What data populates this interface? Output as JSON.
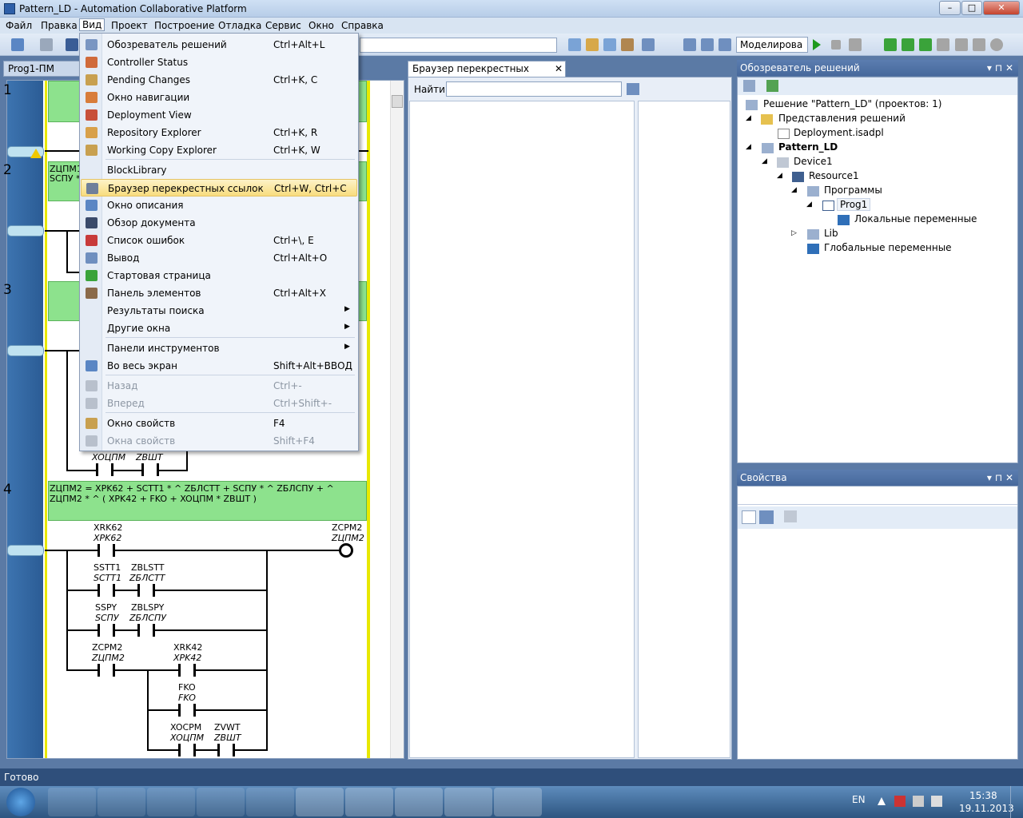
{
  "window": {
    "title": "Pattern_LD - Automation Collaborative Platform",
    "min": "–",
    "max": "□",
    "close": "✕"
  },
  "menubar": [
    "Файл",
    "Правка",
    "Вид",
    "Проект",
    "Построение",
    "Отладка",
    "Сервис",
    "Окно",
    "Справка"
  ],
  "toolbar": {
    "sim_mode": "Моделирова"
  },
  "editor": {
    "tab": "Prog1-ПМ",
    "rungs": [
      {
        "num": "1"
      },
      {
        "num": "2",
        "text_a": "ZЦПМ1",
        "text_b": "SCПУ *"
      },
      {
        "num": "3"
      },
      {
        "num": "4",
        "expr": "ZЦПМ2  =  XPK62 + SCTT1 * ^  ZБЛСТТ + SCПУ * ^  ZБЛСПУ + ^  ZЦПМ2 * ^  (   XPK42 + FKO + XOЦПМ * ZBШТ )"
      }
    ],
    "r3_labels": {
      "a": "XOЦПМ",
      "b": "ZBШТ"
    },
    "r4": {
      "c1": {
        "top": "XRK62",
        "bot": "XPK62"
      },
      "coil": {
        "top": "ZCPM2",
        "bot": "ZЦПМ2"
      },
      "c2": {
        "top": "SSTT1",
        "bot": "SCTT1"
      },
      "c3": {
        "top": "ZBLSTT",
        "bot": "ZБЛСТТ"
      },
      "c4": {
        "top": "SSPY",
        "bot": "SCПУ"
      },
      "c5": {
        "top": "ZBLSPY",
        "bot": "ZБЛСПУ"
      },
      "c6": {
        "top": "ZCPM2",
        "bot": "ZЦПМ2"
      },
      "c7": {
        "top": "XRK42",
        "bot": "XPK42"
      },
      "c8": {
        "top": "FKO",
        "bot": "FKO"
      },
      "c9": {
        "top": "XOCPM",
        "bot": "XOЦПМ"
      },
      "c10": {
        "top": "ZVWT",
        "bot": "ZBШТ"
      }
    }
  },
  "cross_ref": {
    "tab": "Браузер перекрестных ссылок",
    "close": "✕",
    "find_label": "Найти"
  },
  "solution": {
    "title": "Обозреватель решений",
    "pin": "▾ ⊓ ✕",
    "items": [
      {
        "label": "Решение \"Pattern_LD\"  (проектов: 1)"
      },
      {
        "label": "Представления решений"
      },
      {
        "label": "Deployment.isadpl"
      },
      {
        "label": "Pattern_LD"
      },
      {
        "label": "Device1"
      },
      {
        "label": "Resource1"
      },
      {
        "label": "Программы"
      },
      {
        "label": "Prog1"
      },
      {
        "label": "Локальные переменные"
      },
      {
        "label": "Lib"
      },
      {
        "label": "Глобальные переменные"
      }
    ]
  },
  "properties": {
    "title": "Свойства",
    "pin": "▾ ⊓ ✕"
  },
  "status": "Готово",
  "tray": {
    "lang": "EN",
    "time": "15:38",
    "date": "19.11.2013"
  },
  "menu": [
    {
      "label": "Обозреватель решений",
      "shortcut": "Ctrl+Alt+L",
      "icon": "solution-explorer-icon"
    },
    {
      "label": "Controller Status",
      "shortcut": "",
      "icon": "controller-status-icon"
    },
    {
      "label": "Pending Changes",
      "shortcut": "Ctrl+K, C",
      "icon": "pending-changes-icon"
    },
    {
      "label": "Окно навигации",
      "shortcut": "",
      "icon": "navigation-icon"
    },
    {
      "label": "Deployment View",
      "shortcut": "",
      "icon": "deployment-icon"
    },
    {
      "label": "Repository Explorer",
      "shortcut": "Ctrl+K, R",
      "icon": "repository-icon"
    },
    {
      "label": "Working Copy Explorer",
      "shortcut": "Ctrl+K, W",
      "icon": "working-copy-icon"
    },
    {
      "label": "BlockLibrary",
      "shortcut": "",
      "icon": ""
    },
    {
      "label": "Браузер перекрестных ссылок",
      "shortcut": "Ctrl+W, Ctrl+C",
      "icon": "magnifier-icon"
    },
    {
      "label": "Окно описания",
      "shortcut": "",
      "icon": "description-icon"
    },
    {
      "label": "Обзор документа",
      "shortcut": "",
      "icon": "document-outline-icon"
    },
    {
      "label": "Список ошибок",
      "shortcut": "Ctrl+\\, E",
      "icon": "error-list-icon"
    },
    {
      "label": "Вывод",
      "shortcut": "Ctrl+Alt+O",
      "icon": "output-icon"
    },
    {
      "label": "Стартовая страница",
      "shortcut": "",
      "icon": "start-page-icon"
    },
    {
      "label": "Панель элементов",
      "shortcut": "Ctrl+Alt+X",
      "icon": "toolbox-icon"
    },
    {
      "label": "Результаты поиска",
      "shortcut": "",
      "icon": ""
    },
    {
      "label": "Другие окна",
      "shortcut": "",
      "icon": ""
    },
    {
      "label": "Панели инструментов",
      "shortcut": "",
      "icon": ""
    },
    {
      "label": "Во весь экран",
      "shortcut": "Shift+Alt+ВВОД",
      "icon": "fullscreen-icon"
    },
    {
      "label": "Назад",
      "shortcut": "Ctrl+-",
      "icon": "back-icon"
    },
    {
      "label": "Вперед",
      "shortcut": "Ctrl+Shift+-",
      "icon": "forward-icon"
    },
    {
      "label": "Окно свойств",
      "shortcut": "F4",
      "icon": "properties-icon"
    },
    {
      "label": "Окна свойств",
      "shortcut": "Shift+F4",
      "icon": "property-pages-icon"
    }
  ]
}
